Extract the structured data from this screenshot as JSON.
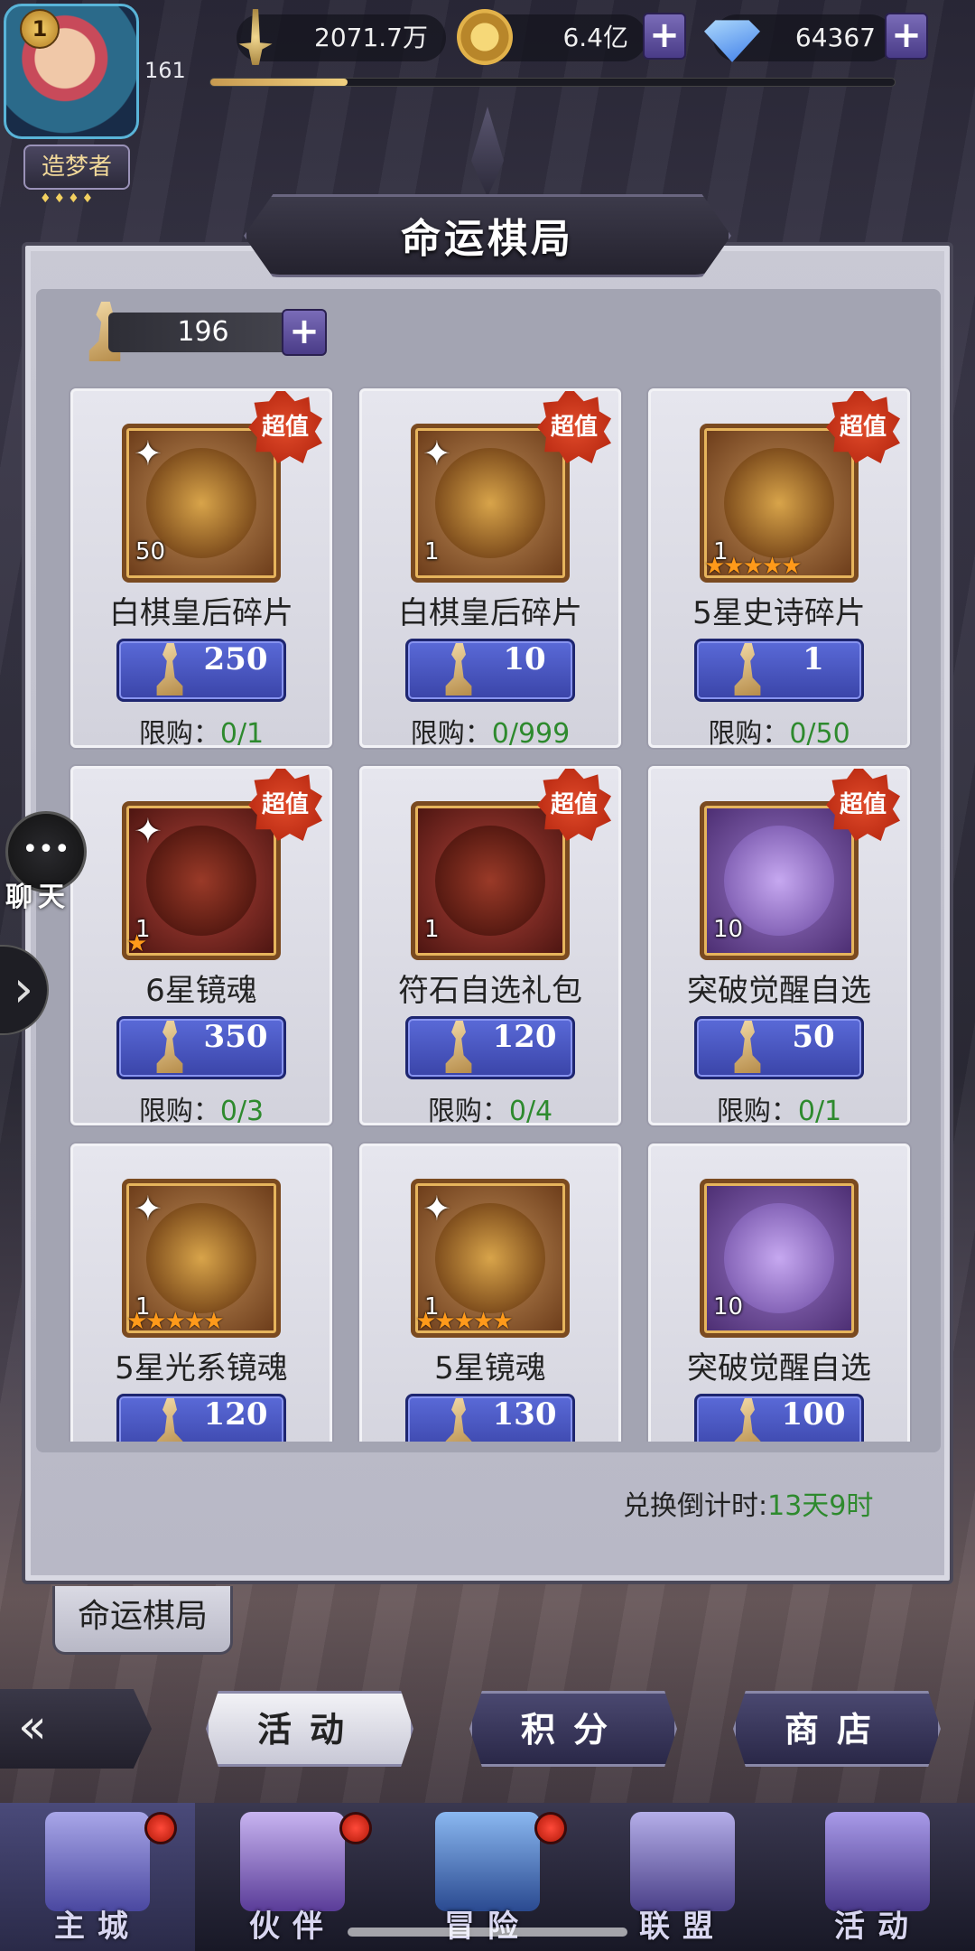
{
  "player": {
    "level_badge": "1",
    "level": "161",
    "title": "造梦者",
    "title_stars": "♦♦♦♦",
    "exp_fraction": 0.2
  },
  "resources": [
    {
      "name": "sword-icon",
      "value": "2071.7万"
    },
    {
      "name": "gold-coin-icon",
      "value": "6.4亿"
    },
    {
      "name": "diamond-icon",
      "value": "64367"
    }
  ],
  "header": {
    "title": "命运棋局"
  },
  "currency": {
    "value": "196"
  },
  "items": [
    {
      "name": "白棋皇后碎片",
      "qty": "50",
      "price": "250",
      "limit_label": "限购：",
      "limit_value": "0/1",
      "deal": "超值",
      "stars": "",
      "frag": true,
      "bg": "gold"
    },
    {
      "name": "白棋皇后碎片",
      "qty": "1",
      "price": "10",
      "limit_label": "限购：",
      "limit_value": "0/999",
      "deal": "超值",
      "stars": "",
      "frag": true,
      "bg": "gold"
    },
    {
      "name": "5星史诗碎片",
      "qty": "1",
      "price": "1",
      "limit_label": "限购：",
      "limit_value": "0/50",
      "deal": "超值",
      "stars": "★★★★★",
      "frag": false,
      "bg": "gold"
    },
    {
      "name": "6星镜魂",
      "qty": "1",
      "price": "350",
      "limit_label": "限购：",
      "limit_value": "0/3",
      "deal": "超值",
      "stars": "★",
      "frag": true,
      "bg": "red"
    },
    {
      "name": "符石自选礼包",
      "qty": "1",
      "price": "120",
      "limit_label": "限购：",
      "limit_value": "0/4",
      "deal": "超值",
      "stars": "",
      "frag": false,
      "bg": "red"
    },
    {
      "name": "突破觉醒自选",
      "qty": "10",
      "price": "50",
      "limit_label": "限购：",
      "limit_value": "0/1",
      "deal": "超值",
      "stars": "",
      "frag": false,
      "bg": "purple"
    },
    {
      "name": "5星光系镜魂",
      "qty": "1",
      "price": "120",
      "limit_label": "",
      "limit_value": "",
      "deal": "",
      "stars": "★★★★★",
      "frag": true,
      "bg": "gold"
    },
    {
      "name": "5星镜魂",
      "qty": "1",
      "price": "130",
      "limit_label": "",
      "limit_value": "",
      "deal": "",
      "stars": "★★★★★",
      "frag": true,
      "bg": "gold"
    },
    {
      "name": "突破觉醒自选",
      "qty": "10",
      "price": "100",
      "limit_label": "",
      "limit_value": "",
      "deal": "",
      "stars": "",
      "frag": false,
      "bg": "purple"
    }
  ],
  "countdown": {
    "label": "兑换倒计时:",
    "value": "13天9时"
  },
  "chat": {
    "label": "聊天",
    "icon": "chat-bubble-icon"
  },
  "tab_label": "命运棋局",
  "nav_buttons": [
    "活动",
    "积分",
    "商店"
  ],
  "bottom_nav": [
    {
      "label": "主城",
      "icon": "castle-icon",
      "dot": true,
      "active": true
    },
    {
      "label": "伙伴",
      "icon": "witch-hat-icon",
      "dot": true,
      "active": false
    },
    {
      "label": "冒险",
      "icon": "compass-icon",
      "dot": true,
      "active": false
    },
    {
      "label": "联盟",
      "icon": "shield-icon",
      "dot": false,
      "active": false
    },
    {
      "label": "活动",
      "icon": "cards-icon",
      "dot": false,
      "active": false
    }
  ],
  "colors": {
    "accent": "#4a56c8",
    "limit_green": "#2e8a2e",
    "deal_red": "#d83a1e"
  }
}
